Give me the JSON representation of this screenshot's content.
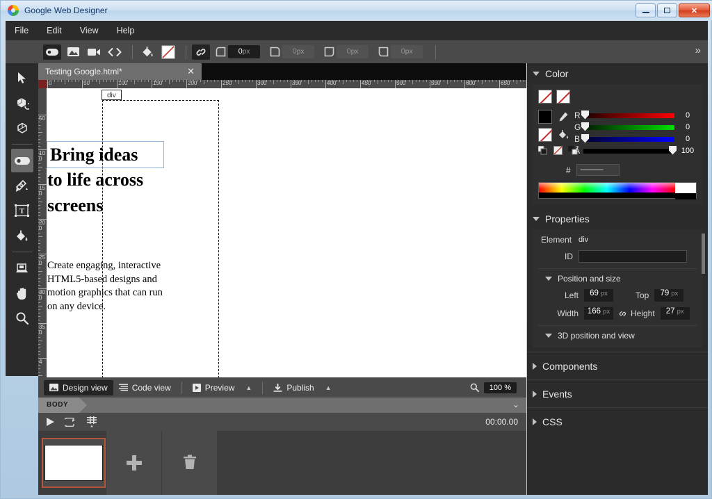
{
  "window": {
    "title": "Google Web Designer",
    "controls": {
      "minimize": "minimize-icon",
      "maximize": "maximize-icon",
      "close": "✕"
    }
  },
  "menu": {
    "items": [
      "File",
      "Edit",
      "View",
      "Help"
    ]
  },
  "toolbar": {
    "tools": [
      {
        "name": "tag-tool",
        "active": true
      },
      {
        "name": "image-tool",
        "active": false
      },
      {
        "name": "video-tool",
        "active": false
      },
      {
        "name": "code-tool",
        "active": false
      }
    ],
    "fill_icon": "paint-bucket-icon",
    "stroke_icon": "no-stroke-swatch",
    "link_icon": "link-chain-icon",
    "link_active": true,
    "corner_radius": [
      {
        "corner": "top-left",
        "value": "0",
        "unit": "px",
        "filled": true
      },
      {
        "corner": "top-right",
        "value": "0",
        "unit": "px",
        "filled": false
      },
      {
        "corner": "bottom-right",
        "value": "0",
        "unit": "px",
        "filled": false
      },
      {
        "corner": "bottom-left",
        "value": "0",
        "unit": "px",
        "filled": false
      }
    ],
    "overflow": "»"
  },
  "tool_rail": {
    "items": [
      {
        "name": "selection-tool",
        "active": false
      },
      {
        "name": "3d-rotate-tool",
        "active": false
      },
      {
        "name": "3d-translate-tool",
        "active": false
      },
      {
        "name": "tag-div-tool",
        "active": true
      },
      {
        "name": "pen-tool",
        "active": false
      },
      {
        "name": "text-tool",
        "active": false
      },
      {
        "name": "paint-bucket-tool",
        "active": false
      },
      {
        "name": "stage-tool",
        "active": false
      },
      {
        "name": "hand-tool",
        "active": false
      },
      {
        "name": "zoom-tool",
        "active": false
      }
    ]
  },
  "document_tab": {
    "label": "Testing Google.html*",
    "close": "✕"
  },
  "canvas": {
    "element_tag": "div",
    "headline_selected": "Bring ideas",
    "headline_rest": "to life across screens",
    "body_copy": "Create engaging, interactive HTML5-based designs and motion graphics that can run on any device.",
    "ruler_h_labels": [
      "0",
      "50",
      "100",
      "150",
      "200",
      "250",
      "300",
      "350",
      "400",
      "450",
      "500",
      "550",
      "600",
      "650"
    ],
    "ruler_v_labels": [
      "50",
      "100",
      "150",
      "200",
      "250",
      "300",
      "350",
      "4"
    ]
  },
  "view_bar": {
    "design_view": "Design view",
    "code_view": "Code view",
    "preview": "Preview",
    "publish": "Publish",
    "caret": "▲",
    "zoom_icon": "magnifier-icon",
    "zoom_value": "100",
    "zoom_unit": "%"
  },
  "breadcrumb": {
    "body": "BODY",
    "expand": "⌄"
  },
  "timeline": {
    "play_icon": "play-icon",
    "loop_icon": "loop-icon",
    "mode_icon": "timeline-mode-icon",
    "time": "00:00.00"
  },
  "frames": {
    "add_label": "+",
    "delete_label": "delete-icon",
    "frame_count": 1
  },
  "panels": {
    "color": {
      "title": "Color",
      "channels": [
        {
          "label": "R",
          "value": "0",
          "pos": 0
        },
        {
          "label": "G",
          "value": "0",
          "pos": 0
        },
        {
          "label": "B",
          "value": "0",
          "pos": 0
        }
      ],
      "alpha": {
        "label": "A",
        "value": "100",
        "pos": 100
      },
      "hex_label": "#",
      "hex_value": "———",
      "accent_red": "#ff0000",
      "accent_green": "#00e000",
      "accent_blue": "#0000ff"
    },
    "properties": {
      "title": "Properties",
      "element_label": "Element",
      "element_value": "div",
      "id_label": "ID",
      "id_value": "",
      "position_section": "Position and size",
      "left_label": "Left",
      "left_value": "69",
      "left_unit": "px",
      "top_label": "Top",
      "top_value": "79",
      "top_unit": "px",
      "width_label": "Width",
      "width_value": "166",
      "width_unit": "px",
      "height_label": "Height",
      "height_value": "27",
      "height_unit": "px",
      "link_icon": "link-aspect-icon",
      "view3d_section": "3D position and view"
    },
    "collapsed": [
      {
        "title": "Components"
      },
      {
        "title": "Events"
      },
      {
        "title": "CSS"
      }
    ]
  }
}
